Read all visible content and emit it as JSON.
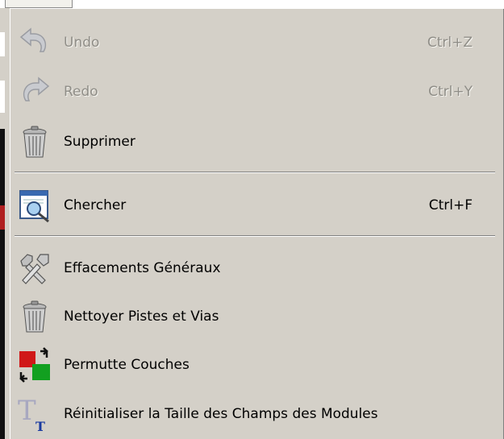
{
  "menu_items": {
    "undo": {
      "label": "Undo",
      "shortcut": "Ctrl+Z"
    },
    "redo": {
      "label": "Redo",
      "shortcut": "Ctrl+Y"
    },
    "supprimer": {
      "label": "Supprimer"
    },
    "chercher": {
      "label": "Chercher",
      "shortcut": "Ctrl+F"
    },
    "effacements": {
      "label": "Effacements Généraux"
    },
    "nettoyer": {
      "label": "Nettoyer Pistes et Vias"
    },
    "permutte": {
      "label": "Permutte Couches"
    },
    "reinit": {
      "label": "Réinitialiser la Taille des Champs des Modules"
    }
  },
  "colors": {
    "menu_bg": "#d4d0c8",
    "disabled_text": "#8f8d87",
    "separator_dark": "#808080",
    "separator_light": "#ffffff"
  }
}
